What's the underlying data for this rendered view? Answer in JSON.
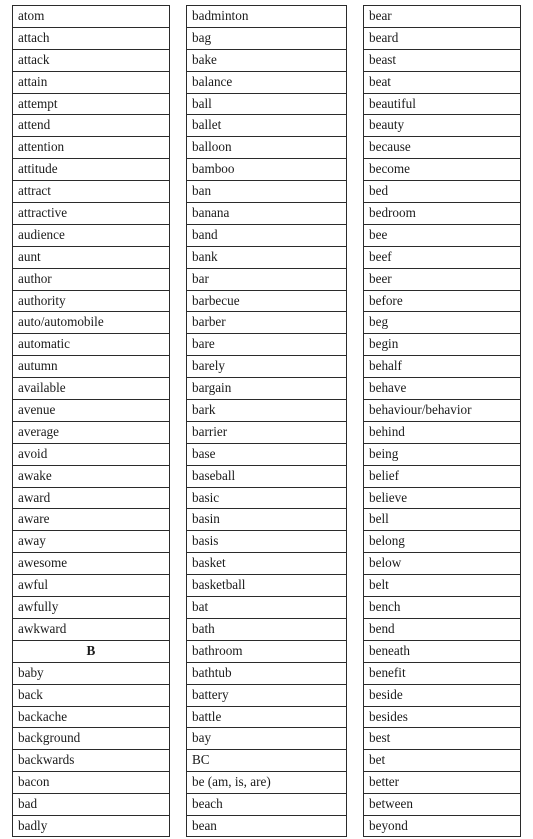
{
  "document": {
    "type": "vocabulary-word-list-table",
    "columns_count": 3,
    "background_color": "#ffffff",
    "text_color": "#1a1a1a",
    "border_color": "#2b2b2b"
  },
  "columns": [
    {
      "id": "column-1",
      "rows": [
        {
          "text": "atom",
          "heading": false
        },
        {
          "text": "attach",
          "heading": false
        },
        {
          "text": "attack",
          "heading": false
        },
        {
          "text": "attain",
          "heading": false
        },
        {
          "text": "attempt",
          "heading": false
        },
        {
          "text": "attend",
          "heading": false
        },
        {
          "text": "attention",
          "heading": false
        },
        {
          "text": "attitude",
          "heading": false
        },
        {
          "text": "attract",
          "heading": false
        },
        {
          "text": "attractive",
          "heading": false
        },
        {
          "text": "audience",
          "heading": false
        },
        {
          "text": "aunt",
          "heading": false
        },
        {
          "text": "author",
          "heading": false
        },
        {
          "text": "authority",
          "heading": false
        },
        {
          "text": "auto/automobile",
          "heading": false
        },
        {
          "text": "automatic",
          "heading": false
        },
        {
          "text": "autumn",
          "heading": false
        },
        {
          "text": "available",
          "heading": false
        },
        {
          "text": "avenue",
          "heading": false
        },
        {
          "text": "average",
          "heading": false
        },
        {
          "text": "avoid",
          "heading": false
        },
        {
          "text": "awake",
          "heading": false
        },
        {
          "text": "award",
          "heading": false
        },
        {
          "text": "aware",
          "heading": false
        },
        {
          "text": "away",
          "heading": false
        },
        {
          "text": "awesome",
          "heading": false
        },
        {
          "text": "awful",
          "heading": false
        },
        {
          "text": "awfully",
          "heading": false
        },
        {
          "text": "awkward",
          "heading": false
        },
        {
          "text": "B",
          "heading": true
        },
        {
          "text": "baby",
          "heading": false
        },
        {
          "text": "back",
          "heading": false
        },
        {
          "text": "backache",
          "heading": false
        },
        {
          "text": "background",
          "heading": false
        },
        {
          "text": "backwards",
          "heading": false
        },
        {
          "text": "bacon",
          "heading": false
        },
        {
          "text": "bad",
          "heading": false
        },
        {
          "text": "badly",
          "heading": false
        }
      ]
    },
    {
      "id": "column-2",
      "rows": [
        {
          "text": "badminton",
          "heading": false
        },
        {
          "text": "bag",
          "heading": false
        },
        {
          "text": "bake",
          "heading": false
        },
        {
          "text": "balance",
          "heading": false
        },
        {
          "text": "ball",
          "heading": false
        },
        {
          "text": "ballet",
          "heading": false
        },
        {
          "text": "balloon",
          "heading": false
        },
        {
          "text": "bamboo",
          "heading": false
        },
        {
          "text": "ban",
          "heading": false
        },
        {
          "text": "banana",
          "heading": false
        },
        {
          "text": "band",
          "heading": false
        },
        {
          "text": "bank",
          "heading": false
        },
        {
          "text": "bar",
          "heading": false
        },
        {
          "text": "barbecue",
          "heading": false
        },
        {
          "text": "barber",
          "heading": false
        },
        {
          "text": "bare",
          "heading": false
        },
        {
          "text": "barely",
          "heading": false
        },
        {
          "text": "bargain",
          "heading": false
        },
        {
          "text": "bark",
          "heading": false
        },
        {
          "text": "barrier",
          "heading": false
        },
        {
          "text": "base",
          "heading": false
        },
        {
          "text": "baseball",
          "heading": false
        },
        {
          "text": "basic",
          "heading": false
        },
        {
          "text": "basin",
          "heading": false
        },
        {
          "text": "basis",
          "heading": false
        },
        {
          "text": "basket",
          "heading": false
        },
        {
          "text": "basketball",
          "heading": false
        },
        {
          "text": "bat",
          "heading": false
        },
        {
          "text": "bath",
          "heading": false
        },
        {
          "text": "bathroom",
          "heading": false
        },
        {
          "text": "bathtub",
          "heading": false
        },
        {
          "text": "battery",
          "heading": false
        },
        {
          "text": "battle",
          "heading": false
        },
        {
          "text": "bay",
          "heading": false
        },
        {
          "text": "BC",
          "heading": false
        },
        {
          "text": "be (am, is, are)",
          "heading": false
        },
        {
          "text": "beach",
          "heading": false
        },
        {
          "text": "bean",
          "heading": false
        }
      ]
    },
    {
      "id": "column-3",
      "rows": [
        {
          "text": "bear",
          "heading": false
        },
        {
          "text": "beard",
          "heading": false
        },
        {
          "text": "beast",
          "heading": false
        },
        {
          "text": "beat",
          "heading": false
        },
        {
          "text": "beautiful",
          "heading": false
        },
        {
          "text": "beauty",
          "heading": false
        },
        {
          "text": "because",
          "heading": false
        },
        {
          "text": "become",
          "heading": false
        },
        {
          "text": "bed",
          "heading": false
        },
        {
          "text": "bedroom",
          "heading": false
        },
        {
          "text": "bee",
          "heading": false
        },
        {
          "text": "beef",
          "heading": false
        },
        {
          "text": "beer",
          "heading": false
        },
        {
          "text": "before",
          "heading": false
        },
        {
          "text": "beg",
          "heading": false
        },
        {
          "text": "begin",
          "heading": false
        },
        {
          "text": "behalf",
          "heading": false
        },
        {
          "text": "behave",
          "heading": false
        },
        {
          "text": "behaviour/behavior",
          "heading": false
        },
        {
          "text": "behind",
          "heading": false
        },
        {
          "text": "being",
          "heading": false
        },
        {
          "text": "belief",
          "heading": false
        },
        {
          "text": "believe",
          "heading": false
        },
        {
          "text": "bell",
          "heading": false
        },
        {
          "text": "belong",
          "heading": false
        },
        {
          "text": "below",
          "heading": false
        },
        {
          "text": "belt",
          "heading": false
        },
        {
          "text": "bench",
          "heading": false
        },
        {
          "text": "bend",
          "heading": false
        },
        {
          "text": "beneath",
          "heading": false
        },
        {
          "text": "benefit",
          "heading": false
        },
        {
          "text": "beside",
          "heading": false
        },
        {
          "text": "besides",
          "heading": false
        },
        {
          "text": "best",
          "heading": false
        },
        {
          "text": "bet",
          "heading": false
        },
        {
          "text": "better",
          "heading": false
        },
        {
          "text": "between",
          "heading": false
        },
        {
          "text": "beyond",
          "heading": false
        }
      ]
    }
  ]
}
